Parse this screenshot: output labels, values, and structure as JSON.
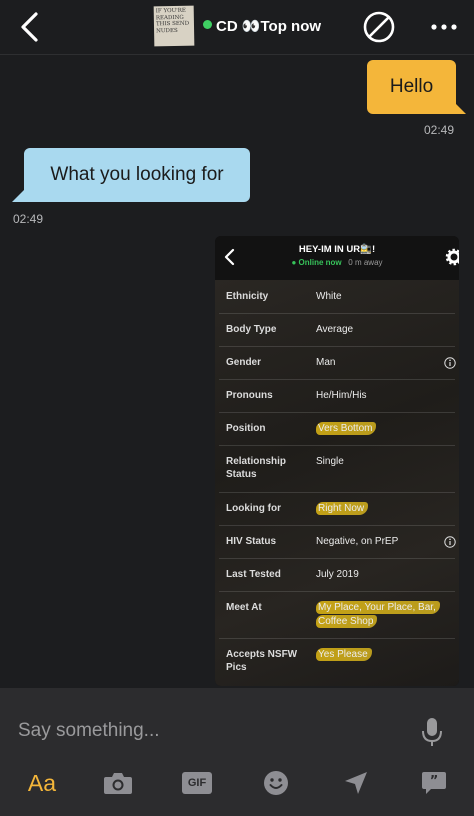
{
  "header": {
    "avatar_text": "If you're reading this send nudes",
    "name": "CD 👀Top now",
    "status_color": "#3fcf63"
  },
  "messages": [
    {
      "direction": "outgoing",
      "text": "Hello",
      "time": "02:49",
      "color": "#f4b63a"
    },
    {
      "direction": "incoming",
      "text": "What you looking for",
      "time": "02:49",
      "color": "#a9d9ef"
    }
  ],
  "profile_screenshot": {
    "title": "HEY-IM IN UR🚉!",
    "online_text": "● Online now",
    "distance": "0 m away",
    "rows": [
      {
        "label": "Ethnicity",
        "value": "White"
      },
      {
        "label": "Body Type",
        "value": "Average"
      },
      {
        "label": "Gender",
        "value": "Man",
        "info_icon": true
      },
      {
        "label": "Pronouns",
        "value": "He/Him/His"
      },
      {
        "label": "Position",
        "value": "Vers Bottom",
        "highlighted": true
      },
      {
        "label": "Relationship Status",
        "value": "Single"
      },
      {
        "label": "Looking for",
        "value": "Right Now",
        "highlighted": true
      },
      {
        "label": "HIV Status",
        "value": "Negative, on PrEP",
        "info_icon": true
      },
      {
        "label": "Last Tested",
        "value": "July 2019"
      },
      {
        "label": "Meet At",
        "value": "My Place, Your Place, Bar, Coffee Shop",
        "highlighted": true
      },
      {
        "label": "Accepts NSFW Pics",
        "value": "Yes Please",
        "highlighted": true
      }
    ]
  },
  "composer": {
    "placeholder": "Say something...",
    "text_button_label": "Aa",
    "gif_label": "GIF",
    "accent": "#f4b63a"
  }
}
